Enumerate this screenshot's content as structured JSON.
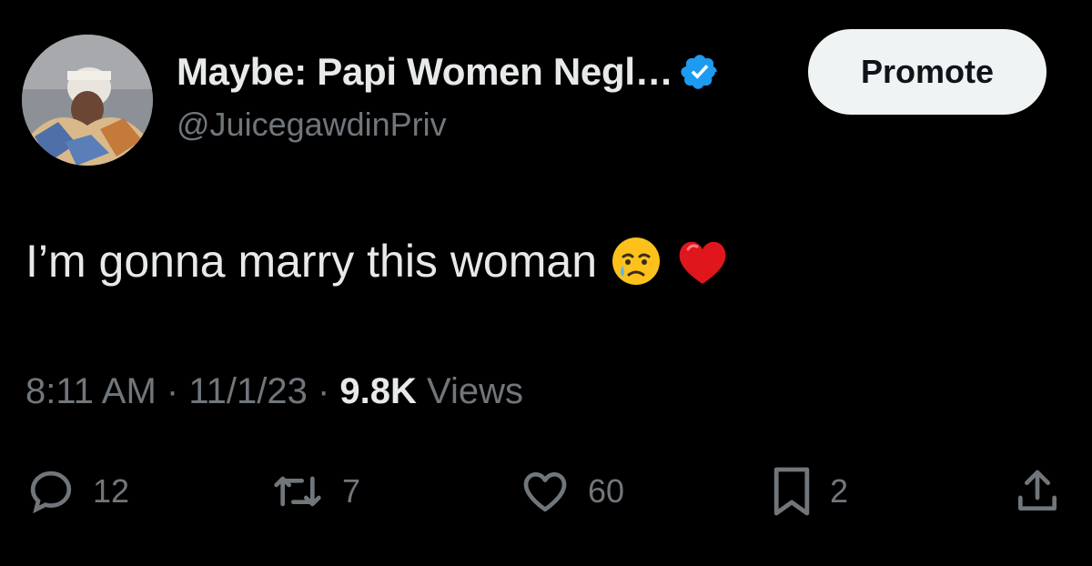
{
  "tweet": {
    "display_name": "Maybe: Papi Women Negl…",
    "handle": "@JuicegawdinPriv",
    "promote_label": "Promote",
    "text": "I’m gonna marry this woman",
    "emojis": [
      "crying-face-emoji",
      "red-heart-emoji"
    ],
    "time": "8:11 AM",
    "separator": " · ",
    "date": "11/1/23",
    "views_count": "9.8K",
    "views_label": "Views"
  },
  "actions": {
    "replies": "12",
    "retweets": "7",
    "likes": "60",
    "bookmarks": "2"
  },
  "icons": {
    "verified": "verified-badge-icon",
    "reply": "reply-icon",
    "retweet": "retweet-icon",
    "like": "heart-icon",
    "bookmark": "bookmark-icon",
    "share": "share-icon"
  },
  "colors": {
    "background": "#000000",
    "text": "#e7e9ea",
    "secondary_text": "#71767b",
    "verified_blue": "#1d9bf0",
    "promote_bg": "#eff3f4"
  }
}
